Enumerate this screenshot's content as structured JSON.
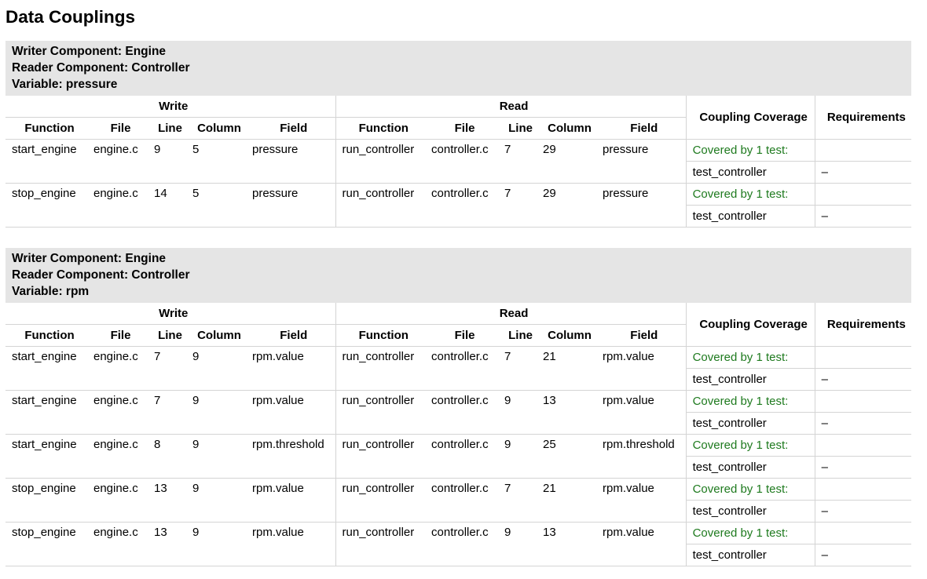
{
  "title": "Data Couplings",
  "headers": {
    "write": "Write",
    "read": "Read",
    "coverage": "Coupling Coverage",
    "requirements": "Requirements",
    "function": "Function",
    "file": "File",
    "line": "Line",
    "column": "Column",
    "field": "Field"
  },
  "blocks": [
    {
      "writer": "Writer Component: Engine",
      "reader": "Reader Component: Controller",
      "variable": "Variable: pressure",
      "rows": [
        {
          "w_func": "start_engine",
          "w_file": "engine.c",
          "w_line": "9",
          "w_col": "5",
          "w_field": "pressure",
          "r_func": "run_controller",
          "r_file": "controller.c",
          "r_line": "7",
          "r_col": "29",
          "r_field": "pressure",
          "coverage": "Covered by 1 test:",
          "test": "test_controller",
          "req": "–"
        },
        {
          "w_func": "stop_engine",
          "w_file": "engine.c",
          "w_line": "14",
          "w_col": "5",
          "w_field": "pressure",
          "r_func": "run_controller",
          "r_file": "controller.c",
          "r_line": "7",
          "r_col": "29",
          "r_field": "pressure",
          "coverage": "Covered by 1 test:",
          "test": "test_controller",
          "req": "–"
        }
      ]
    },
    {
      "writer": "Writer Component: Engine",
      "reader": "Reader Component: Controller",
      "variable": "Variable: rpm",
      "rows": [
        {
          "w_func": "start_engine",
          "w_file": "engine.c",
          "w_line": "7",
          "w_col": "9",
          "w_field": "rpm.value",
          "r_func": "run_controller",
          "r_file": "controller.c",
          "r_line": "7",
          "r_col": "21",
          "r_field": "rpm.value",
          "coverage": "Covered by 1 test:",
          "test": "test_controller",
          "req": "–"
        },
        {
          "w_func": "start_engine",
          "w_file": "engine.c",
          "w_line": "7",
          "w_col": "9",
          "w_field": "rpm.value",
          "r_func": "run_controller",
          "r_file": "controller.c",
          "r_line": "9",
          "r_col": "13",
          "r_field": "rpm.value",
          "coverage": "Covered by 1 test:",
          "test": "test_controller",
          "req": "–"
        },
        {
          "w_func": "start_engine",
          "w_file": "engine.c",
          "w_line": "8",
          "w_col": "9",
          "w_field": "rpm.threshold",
          "r_func": "run_controller",
          "r_file": "controller.c",
          "r_line": "9",
          "r_col": "25",
          "r_field": "rpm.threshold",
          "coverage": "Covered by 1 test:",
          "test": "test_controller",
          "req": "–"
        },
        {
          "w_func": "stop_engine",
          "w_file": "engine.c",
          "w_line": "13",
          "w_col": "9",
          "w_field": "rpm.value",
          "r_func": "run_controller",
          "r_file": "controller.c",
          "r_line": "7",
          "r_col": "21",
          "r_field": "rpm.value",
          "coverage": "Covered by 1 test:",
          "test": "test_controller",
          "req": "–"
        },
        {
          "w_func": "stop_engine",
          "w_file": "engine.c",
          "w_line": "13",
          "w_col": "9",
          "w_field": "rpm.value",
          "r_func": "run_controller",
          "r_file": "controller.c",
          "r_line": "9",
          "r_col": "13",
          "r_field": "rpm.value",
          "coverage": "Covered by 1 test:",
          "test": "test_controller",
          "req": "–"
        }
      ]
    }
  ]
}
